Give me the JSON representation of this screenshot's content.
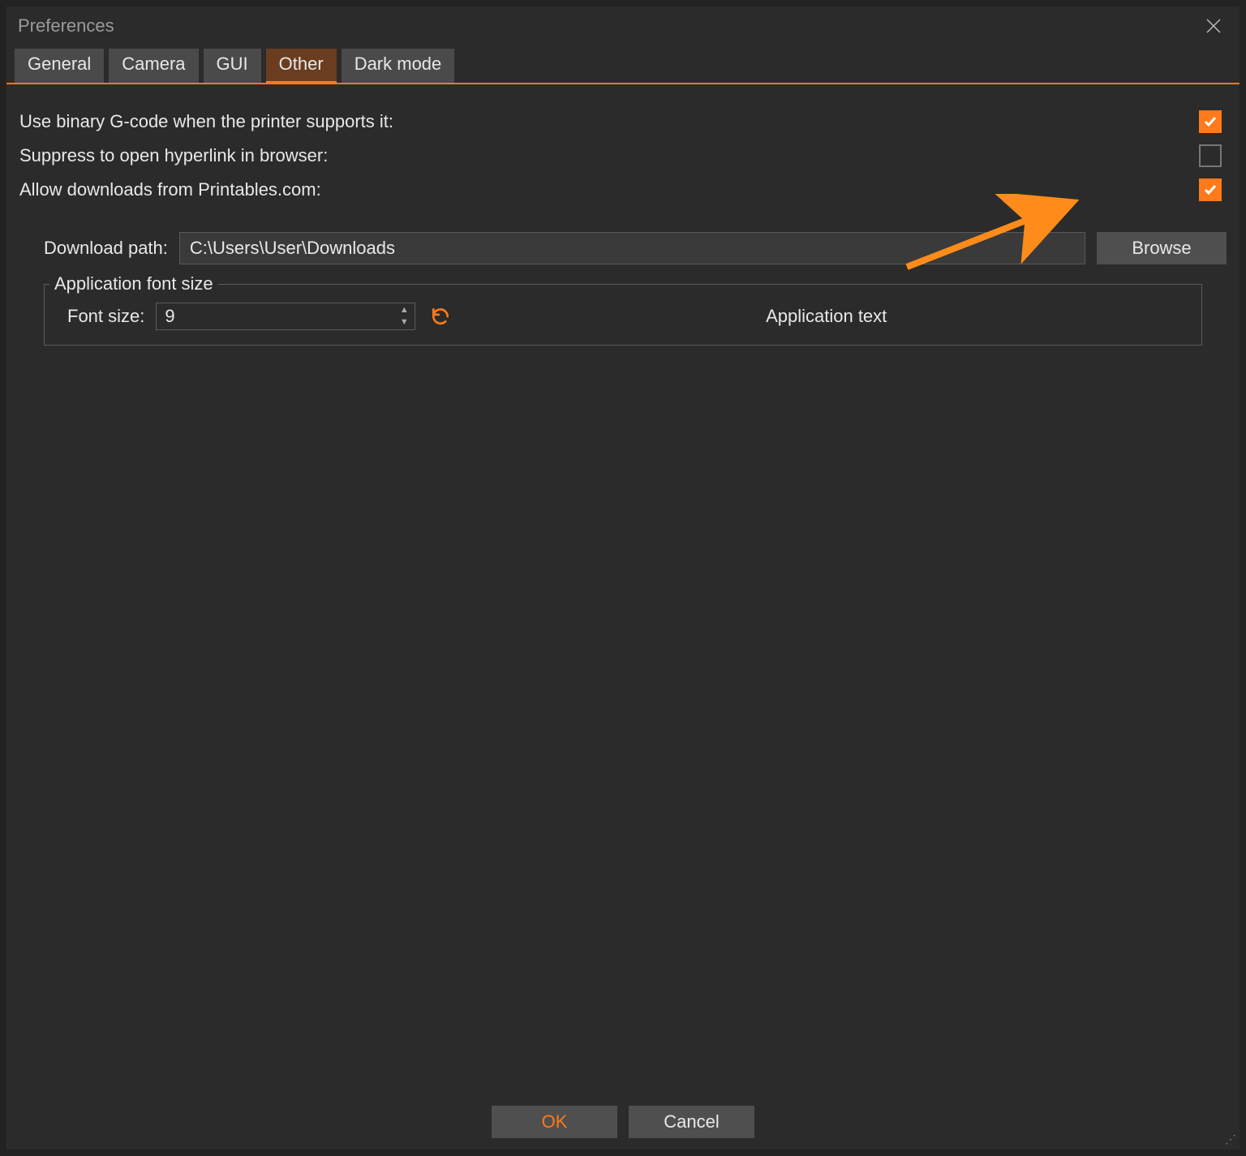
{
  "title": "Preferences",
  "tabs": [
    "General",
    "Camera",
    "GUI",
    "Other",
    "Dark mode"
  ],
  "active_tab": "Other",
  "options": {
    "binary_gcode": {
      "label": "Use binary G-code when the printer supports it:",
      "checked": true
    },
    "suppress_hyperlink": {
      "label": "Suppress to open hyperlink in browser:",
      "checked": false
    },
    "allow_downloads": {
      "label": "Allow downloads from Printables.com:",
      "checked": true
    }
  },
  "download": {
    "label": "Download path:",
    "value": "C:\\Users\\User\\Downloads",
    "browse": "Browse"
  },
  "font_group": {
    "legend": "Application font size",
    "label": "Font size:",
    "value": "9",
    "reset_icon": "reset-icon",
    "sample": "Application text"
  },
  "footer": {
    "ok": "OK",
    "cancel": "Cancel"
  }
}
